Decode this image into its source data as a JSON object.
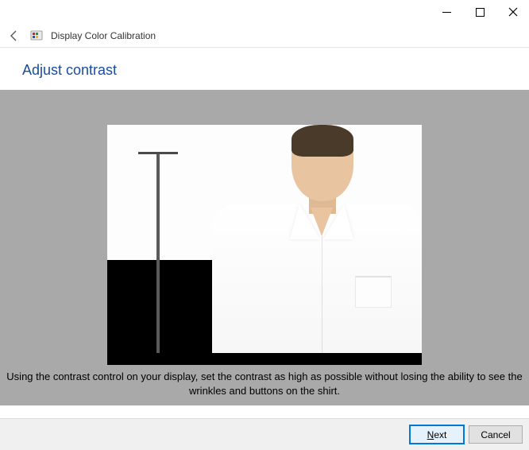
{
  "window": {
    "title": "Display Color Calibration"
  },
  "heading": "Adjust contrast",
  "instruction": "Using the contrast control on your display, set the contrast as high as possible without losing the ability to see the wrinkles and buttons on the shirt.",
  "buttons": {
    "next_prefix": "",
    "next_mnemonic": "N",
    "next_suffix": "ext",
    "cancel": "Cancel"
  }
}
